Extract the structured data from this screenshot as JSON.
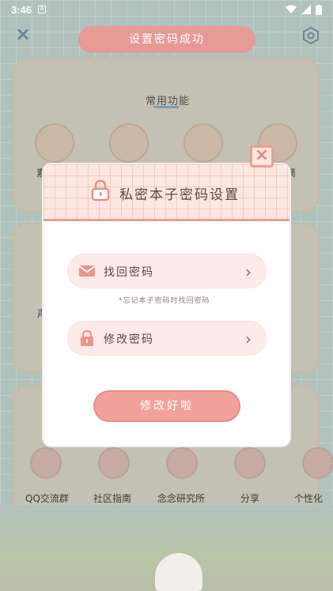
{
  "status_bar": {
    "time": "3:46",
    "notification_glyph": "A"
  },
  "topbar": {
    "title": "设置密码成功",
    "close_icon": "close-icon",
    "settings_icon": "gear-hexagon-icon"
  },
  "background": {
    "section_title": "常用功能",
    "partial_labels": {
      "left_a": "素",
      "right_a": "滴",
      "left_b": "声"
    },
    "bottom_items": [
      {
        "label": "QQ交流群",
        "icon": "qq-icon"
      },
      {
        "label": "社区指南",
        "icon": "heart-icon"
      },
      {
        "label": "念念研究所",
        "icon": "people-icon"
      },
      {
        "label": "分享",
        "icon": "share-icon"
      },
      {
        "label": "个性化",
        "icon": "custom-icon"
      }
    ]
  },
  "modal": {
    "title": "私密本子密码设置",
    "options": [
      {
        "label": "找回密码",
        "icon": "mail-icon",
        "chevron": "›"
      },
      {
        "label": "修改密码",
        "icon": "lock-icon",
        "chevron": "›"
      }
    ],
    "hint": "*忘记本子密码时找回密码",
    "confirm_label": "修改好啦",
    "close_glyph": "×"
  },
  "colors": {
    "accent": "#ec9e95",
    "button": "#f2a29c",
    "title_pill": "#e59a95"
  }
}
